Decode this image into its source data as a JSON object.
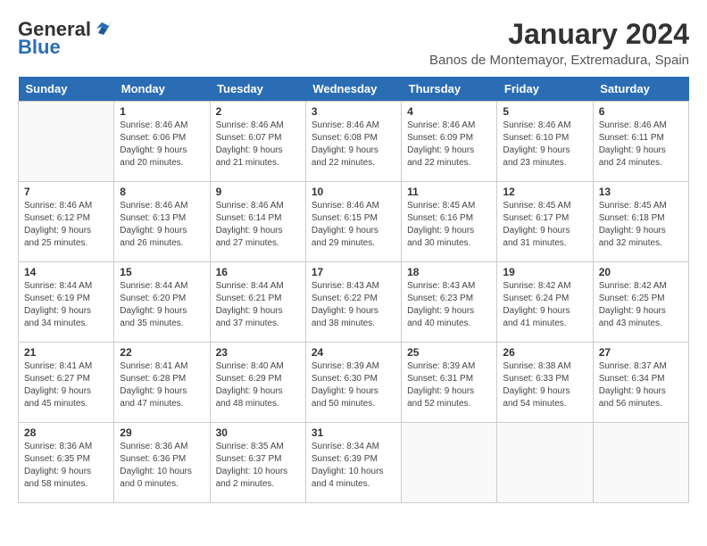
{
  "header": {
    "logo_line1": "General",
    "logo_line2": "Blue",
    "title": "January 2024",
    "subtitle": "Banos de Montemayor, Extremadura, Spain"
  },
  "weekdays": [
    "Sunday",
    "Monday",
    "Tuesday",
    "Wednesday",
    "Thursday",
    "Friday",
    "Saturday"
  ],
  "weeks": [
    [
      {
        "day": "",
        "sunrise": "",
        "sunset": "",
        "daylight": ""
      },
      {
        "day": "1",
        "sunrise": "Sunrise: 8:46 AM",
        "sunset": "Sunset: 6:06 PM",
        "daylight": "Daylight: 9 hours and 20 minutes."
      },
      {
        "day": "2",
        "sunrise": "Sunrise: 8:46 AM",
        "sunset": "Sunset: 6:07 PM",
        "daylight": "Daylight: 9 hours and 21 minutes."
      },
      {
        "day": "3",
        "sunrise": "Sunrise: 8:46 AM",
        "sunset": "Sunset: 6:08 PM",
        "daylight": "Daylight: 9 hours and 22 minutes."
      },
      {
        "day": "4",
        "sunrise": "Sunrise: 8:46 AM",
        "sunset": "Sunset: 6:09 PM",
        "daylight": "Daylight: 9 hours and 22 minutes."
      },
      {
        "day": "5",
        "sunrise": "Sunrise: 8:46 AM",
        "sunset": "Sunset: 6:10 PM",
        "daylight": "Daylight: 9 hours and 23 minutes."
      },
      {
        "day": "6",
        "sunrise": "Sunrise: 8:46 AM",
        "sunset": "Sunset: 6:11 PM",
        "daylight": "Daylight: 9 hours and 24 minutes."
      }
    ],
    [
      {
        "day": "7",
        "sunrise": "Sunrise: 8:46 AM",
        "sunset": "Sunset: 6:12 PM",
        "daylight": "Daylight: 9 hours and 25 minutes."
      },
      {
        "day": "8",
        "sunrise": "Sunrise: 8:46 AM",
        "sunset": "Sunset: 6:13 PM",
        "daylight": "Daylight: 9 hours and 26 minutes."
      },
      {
        "day": "9",
        "sunrise": "Sunrise: 8:46 AM",
        "sunset": "Sunset: 6:14 PM",
        "daylight": "Daylight: 9 hours and 27 minutes."
      },
      {
        "day": "10",
        "sunrise": "Sunrise: 8:46 AM",
        "sunset": "Sunset: 6:15 PM",
        "daylight": "Daylight: 9 hours and 29 minutes."
      },
      {
        "day": "11",
        "sunrise": "Sunrise: 8:45 AM",
        "sunset": "Sunset: 6:16 PM",
        "daylight": "Daylight: 9 hours and 30 minutes."
      },
      {
        "day": "12",
        "sunrise": "Sunrise: 8:45 AM",
        "sunset": "Sunset: 6:17 PM",
        "daylight": "Daylight: 9 hours and 31 minutes."
      },
      {
        "day": "13",
        "sunrise": "Sunrise: 8:45 AM",
        "sunset": "Sunset: 6:18 PM",
        "daylight": "Daylight: 9 hours and 32 minutes."
      }
    ],
    [
      {
        "day": "14",
        "sunrise": "Sunrise: 8:44 AM",
        "sunset": "Sunset: 6:19 PM",
        "daylight": "Daylight: 9 hours and 34 minutes."
      },
      {
        "day": "15",
        "sunrise": "Sunrise: 8:44 AM",
        "sunset": "Sunset: 6:20 PM",
        "daylight": "Daylight: 9 hours and 35 minutes."
      },
      {
        "day": "16",
        "sunrise": "Sunrise: 8:44 AM",
        "sunset": "Sunset: 6:21 PM",
        "daylight": "Daylight: 9 hours and 37 minutes."
      },
      {
        "day": "17",
        "sunrise": "Sunrise: 8:43 AM",
        "sunset": "Sunset: 6:22 PM",
        "daylight": "Daylight: 9 hours and 38 minutes."
      },
      {
        "day": "18",
        "sunrise": "Sunrise: 8:43 AM",
        "sunset": "Sunset: 6:23 PM",
        "daylight": "Daylight: 9 hours and 40 minutes."
      },
      {
        "day": "19",
        "sunrise": "Sunrise: 8:42 AM",
        "sunset": "Sunset: 6:24 PM",
        "daylight": "Daylight: 9 hours and 41 minutes."
      },
      {
        "day": "20",
        "sunrise": "Sunrise: 8:42 AM",
        "sunset": "Sunset: 6:25 PM",
        "daylight": "Daylight: 9 hours and 43 minutes."
      }
    ],
    [
      {
        "day": "21",
        "sunrise": "Sunrise: 8:41 AM",
        "sunset": "Sunset: 6:27 PM",
        "daylight": "Daylight: 9 hours and 45 minutes."
      },
      {
        "day": "22",
        "sunrise": "Sunrise: 8:41 AM",
        "sunset": "Sunset: 6:28 PM",
        "daylight": "Daylight: 9 hours and 47 minutes."
      },
      {
        "day": "23",
        "sunrise": "Sunrise: 8:40 AM",
        "sunset": "Sunset: 6:29 PM",
        "daylight": "Daylight: 9 hours and 48 minutes."
      },
      {
        "day": "24",
        "sunrise": "Sunrise: 8:39 AM",
        "sunset": "Sunset: 6:30 PM",
        "daylight": "Daylight: 9 hours and 50 minutes."
      },
      {
        "day": "25",
        "sunrise": "Sunrise: 8:39 AM",
        "sunset": "Sunset: 6:31 PM",
        "daylight": "Daylight: 9 hours and 52 minutes."
      },
      {
        "day": "26",
        "sunrise": "Sunrise: 8:38 AM",
        "sunset": "Sunset: 6:33 PM",
        "daylight": "Daylight: 9 hours and 54 minutes."
      },
      {
        "day": "27",
        "sunrise": "Sunrise: 8:37 AM",
        "sunset": "Sunset: 6:34 PM",
        "daylight": "Daylight: 9 hours and 56 minutes."
      }
    ],
    [
      {
        "day": "28",
        "sunrise": "Sunrise: 8:36 AM",
        "sunset": "Sunset: 6:35 PM",
        "daylight": "Daylight: 9 hours and 58 minutes."
      },
      {
        "day": "29",
        "sunrise": "Sunrise: 8:36 AM",
        "sunset": "Sunset: 6:36 PM",
        "daylight": "Daylight: 10 hours and 0 minutes."
      },
      {
        "day": "30",
        "sunrise": "Sunrise: 8:35 AM",
        "sunset": "Sunset: 6:37 PM",
        "daylight": "Daylight: 10 hours and 2 minutes."
      },
      {
        "day": "31",
        "sunrise": "Sunrise: 8:34 AM",
        "sunset": "Sunset: 6:39 PM",
        "daylight": "Daylight: 10 hours and 4 minutes."
      },
      {
        "day": "",
        "sunrise": "",
        "sunset": "",
        "daylight": ""
      },
      {
        "day": "",
        "sunrise": "",
        "sunset": "",
        "daylight": ""
      },
      {
        "day": "",
        "sunrise": "",
        "sunset": "",
        "daylight": ""
      }
    ]
  ]
}
